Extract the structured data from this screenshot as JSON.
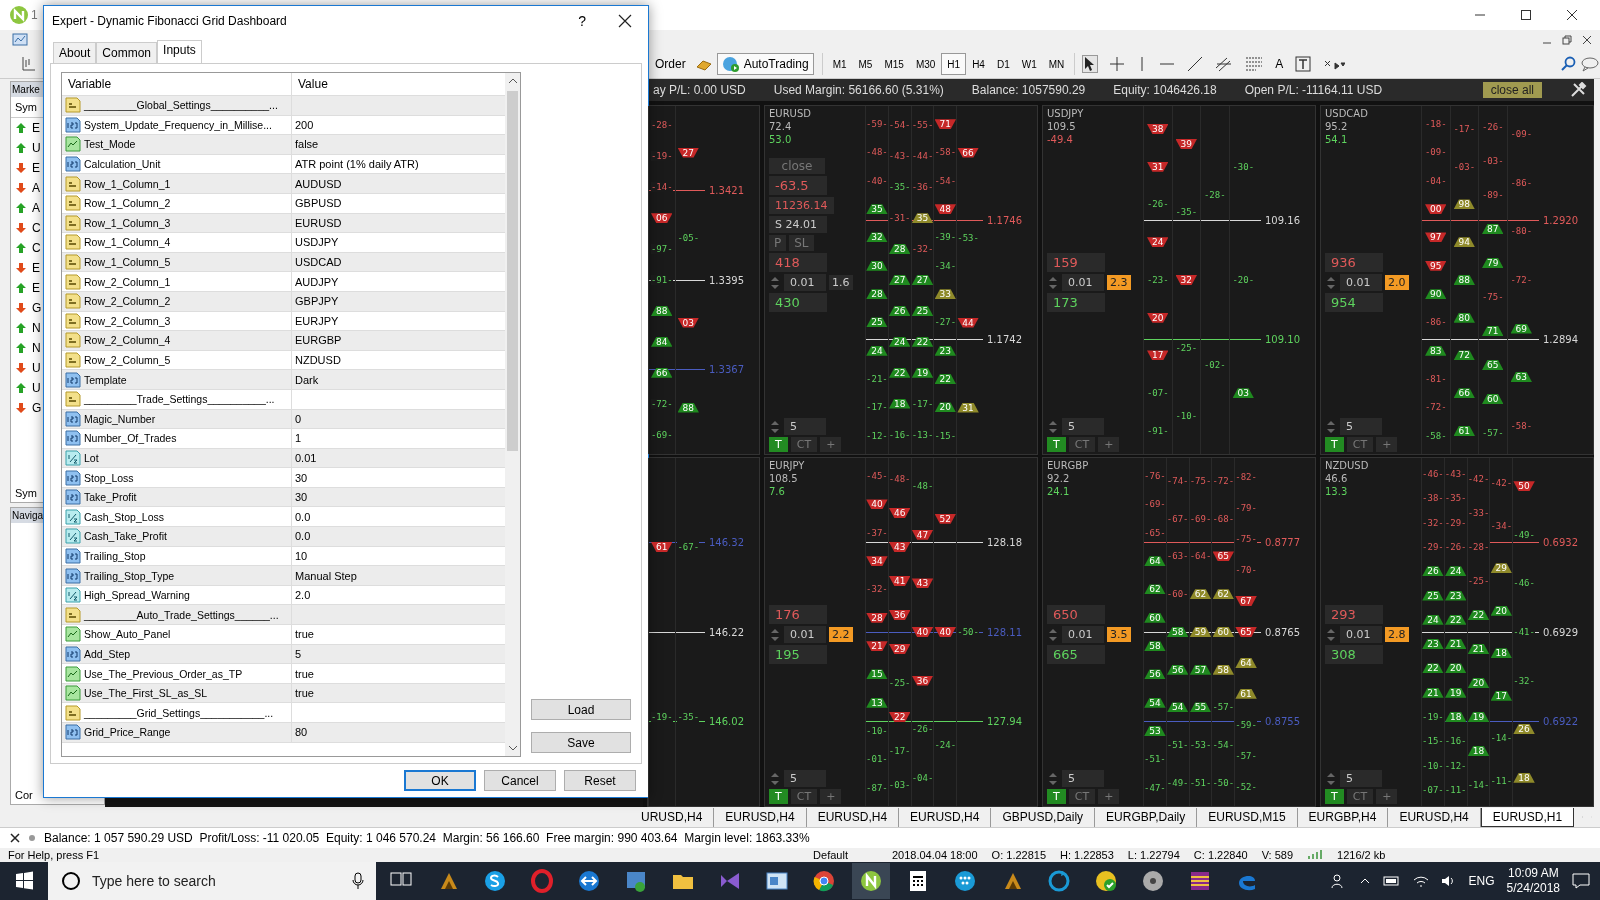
{
  "window": {
    "title_fragment": "1"
  },
  "toolbar": {
    "new_order": "Order",
    "autotrading": "AutoTrading",
    "text_tool": "A",
    "timeframes": [
      {
        "label": "M1",
        "selected": false
      },
      {
        "label": "M5",
        "selected": false
      },
      {
        "label": "M15",
        "selected": false
      },
      {
        "label": "M30",
        "selected": false
      },
      {
        "label": "H1",
        "selected": true
      },
      {
        "label": "H4",
        "selected": false
      },
      {
        "label": "D1",
        "selected": false
      },
      {
        "label": "W1",
        "selected": false
      },
      {
        "label": "MN",
        "selected": false
      }
    ]
  },
  "market_watch": {
    "title": "Marke",
    "header": "Sym",
    "tab": "Sym",
    "rows": [
      {
        "symbol": "E",
        "kind": "up"
      },
      {
        "symbol": "U",
        "kind": "up"
      },
      {
        "symbol": "E",
        "kind": "down"
      },
      {
        "symbol": "A",
        "kind": "down"
      },
      {
        "symbol": "A",
        "kind": "up"
      },
      {
        "symbol": "C",
        "kind": "down"
      },
      {
        "symbol": "C",
        "kind": "up"
      },
      {
        "symbol": "E",
        "kind": "down"
      },
      {
        "symbol": "E",
        "kind": "up"
      },
      {
        "symbol": "G",
        "kind": "down"
      },
      {
        "symbol": "N",
        "kind": "up"
      },
      {
        "symbol": "N",
        "kind": "up"
      },
      {
        "symbol": "U",
        "kind": "down"
      },
      {
        "symbol": "U",
        "kind": "up"
      },
      {
        "symbol": "G",
        "kind": "down"
      }
    ]
  },
  "navigator": {
    "title": "Naviga",
    "tab": "Cor"
  },
  "account_bar": {
    "items": [
      "ay P/L: 0.00 USD",
      "Used Margin: 56166.60 (5.31%)",
      "Balance: 1057590.29",
      "Equity: 1046426.18",
      "Open P/L: -11164.11 USD"
    ],
    "close_all": "close all"
  },
  "panels": [
    {
      "partial": true,
      "columns": [
        [
          {
            "text": "-28-",
            "kind": "dn"
          },
          {
            "text": "-19-",
            "kind": "dn"
          },
          {
            "text": "-14-",
            "kind": "dn"
          },
          {
            "text": "06",
            "kind": "sell"
          },
          {
            "text": "-97-",
            "kind": "up"
          },
          {
            "text": "-91-",
            "kind": "up"
          },
          {
            "text": "88",
            "kind": "buy"
          },
          {
            "text": "84",
            "kind": "buy"
          },
          {
            "text": "66",
            "kind": "buy"
          },
          {
            "text": "-72-",
            "kind": "up"
          },
          {
            "text": "-69-",
            "kind": "up"
          }
        ],
        [
          {
            "text": "27",
            "kind": "sell"
          },
          {
            "text": "-05-",
            "kind": "up"
          },
          {
            "text": "03",
            "kind": "sell"
          },
          {
            "text": "88",
            "kind": "buy"
          }
        ]
      ],
      "price_lines": [
        {
          "label": "1.3421",
          "color": "#e05a5a"
        },
        {
          "label": "1.3395",
          "color": "#d8d8d8"
        },
        {
          "label": "1.3367",
          "color": "#4a5cc0"
        }
      ]
    },
    {
      "symbol": "EURUSD",
      "stat_1": "72.4",
      "stat_2": "53.0",
      "stat_2_negative": false,
      "close_panel": {
        "close": "close",
        "pl": "-63.5",
        "value": "11236.14",
        "swap": "S 24.01",
        "buttons": [
          "P",
          "SL"
        ]
      },
      "sell": "418",
      "lot": "0.01",
      "spread": "1.6",
      "spread_warning": false,
      "buy": "430",
      "step": "5",
      "buttons": [
        {
          "label": "T",
          "on": true
        },
        {
          "label": "CT",
          "on": false
        },
        {
          "label": "+",
          "on": false
        }
      ],
      "columns": [
        [
          {
            "text": "-59-",
            "kind": "dn"
          },
          {
            "text": "-48-",
            "kind": "dn"
          },
          {
            "text": "-40-",
            "kind": "dn"
          },
          {
            "text": "35",
            "kind": "buy"
          },
          {
            "text": "32",
            "kind": "buy"
          },
          {
            "text": "30",
            "kind": "buy"
          },
          {
            "text": "28",
            "kind": "buy"
          },
          {
            "text": "25",
            "kind": "buy"
          },
          {
            "text": "24",
            "kind": "buy"
          },
          {
            "text": "-21-",
            "kind": "up"
          },
          {
            "text": "-17-",
            "kind": "up"
          },
          {
            "text": "-12-",
            "kind": "up"
          }
        ],
        [
          {
            "text": "-54-",
            "kind": "dn"
          },
          {
            "text": "-43-",
            "kind": "dn"
          },
          {
            "text": "-35-",
            "kind": "up"
          },
          {
            "text": "-31-",
            "kind": "dn"
          },
          {
            "text": "28",
            "kind": "buy"
          },
          {
            "text": "27",
            "kind": "buy"
          },
          {
            "text": "26",
            "kind": "buy"
          },
          {
            "text": "24",
            "kind": "buy"
          },
          {
            "text": "22",
            "kind": "buy"
          },
          {
            "text": "18",
            "kind": "buy"
          },
          {
            "text": "-16-",
            "kind": "up"
          }
        ],
        [
          {
            "text": "-55-",
            "kind": "dn"
          },
          {
            "text": "-44-",
            "kind": "dn"
          },
          {
            "text": "-36-",
            "kind": "dn"
          },
          {
            "text": "35",
            "kind": "hold"
          },
          {
            "text": "-32-",
            "kind": "dn"
          },
          {
            "text": "27",
            "kind": "buy"
          },
          {
            "text": "25",
            "kind": "buy"
          },
          {
            "text": "22",
            "kind": "buy"
          },
          {
            "text": "19",
            "kind": "buy"
          },
          {
            "text": "-17-",
            "kind": "up"
          },
          {
            "text": "-13-",
            "kind": "up"
          }
        ],
        [
          {
            "text": "71",
            "kind": "sell"
          },
          {
            "text": "-58-",
            "kind": "dn"
          },
          {
            "text": "-54-",
            "kind": "dn"
          },
          {
            "text": "48",
            "kind": "sell"
          },
          {
            "text": "-39-",
            "kind": "up"
          },
          {
            "text": "-34-",
            "kind": "up"
          },
          {
            "text": "33",
            "kind": "hold"
          },
          {
            "text": "-27-",
            "kind": "up"
          },
          {
            "text": "23",
            "kind": "buy"
          },
          {
            "text": "22",
            "kind": "buy"
          },
          {
            "text": "20",
            "kind": "buy"
          },
          {
            "text": "-15-",
            "kind": "up"
          }
        ],
        [
          {
            "text": "66",
            "kind": "sell"
          },
          {
            "text": "-53-",
            "kind": "up"
          },
          {
            "text": "44",
            "kind": "sell"
          },
          {
            "text": "31",
            "kind": "hold"
          }
        ]
      ],
      "price_lines": [
        {
          "label": "1.1746",
          "color": "#e05a5a"
        },
        {
          "label": "1.1742",
          "color": "#d8d8d8"
        }
      ]
    },
    {
      "symbol": "USDJPY",
      "stat_1": "109.5",
      "stat_2": "-49.4",
      "stat_2_negative": true,
      "sell": "159",
      "lot": "0.01",
      "spread": "2.3",
      "spread_warning": true,
      "buy": "173",
      "step": "5",
      "buttons": [
        {
          "label": "T",
          "on": true
        },
        {
          "label": "CT",
          "on": false
        },
        {
          "label": "+",
          "on": false
        }
      ],
      "columns": [
        [
          {
            "text": "38",
            "kind": "sell"
          },
          {
            "text": "31",
            "kind": "sell"
          },
          {
            "text": "-26-",
            "kind": "up"
          },
          {
            "text": "24",
            "kind": "sell"
          },
          {
            "text": "-23-",
            "kind": "up"
          },
          {
            "text": "20",
            "kind": "sell"
          },
          {
            "text": "17",
            "kind": "sell"
          },
          {
            "text": "-07-",
            "kind": "up"
          },
          {
            "text": "-91-",
            "kind": "up"
          }
        ],
        [
          {
            "text": "39",
            "kind": "sell"
          },
          {
            "text": "-35-",
            "kind": "up"
          },
          {
            "text": "32",
            "kind": "sell"
          },
          {
            "text": "-25-",
            "kind": "up"
          },
          {
            "text": "-10-",
            "kind": "up"
          }
        ],
        [
          {
            "text": "-28-",
            "kind": "up"
          },
          {
            "text": "-02-",
            "kind": "up"
          }
        ],
        [
          {
            "text": "-30-",
            "kind": "up"
          },
          {
            "text": "-20-",
            "kind": "up"
          },
          {
            "text": "03",
            "kind": "buy"
          }
        ]
      ],
      "price_lines": [
        {
          "label": "109.16",
          "color": "#d8d8d8"
        },
        {
          "label": "109.10",
          "color": "#5ed35e"
        }
      ]
    },
    {
      "symbol": "USDCAD",
      "stat_1": "95.2",
      "stat_2": "54.1",
      "stat_2_negative": false,
      "sell": "936",
      "lot": "0.01",
      "spread": "2.0",
      "spread_warning": true,
      "buy": "954",
      "step": "5",
      "buttons": [
        {
          "label": "T",
          "on": true
        },
        {
          "label": "CT",
          "on": false
        },
        {
          "label": "+",
          "on": false
        }
      ],
      "columns": [
        [
          {
            "text": "-18-",
            "kind": "dn"
          },
          {
            "text": "-09-",
            "kind": "dn"
          },
          {
            "text": "-04-",
            "kind": "dn"
          },
          {
            "text": "00",
            "kind": "sell"
          },
          {
            "text": "97",
            "kind": "sell"
          },
          {
            "text": "95",
            "kind": "sell"
          },
          {
            "text": "90",
            "kind": "buy"
          },
          {
            "text": "-86-",
            "kind": "dn"
          },
          {
            "text": "83",
            "kind": "buy"
          },
          {
            "text": "-81-",
            "kind": "dn"
          },
          {
            "text": "-72-",
            "kind": "dn"
          },
          {
            "text": "-58-",
            "kind": "up"
          }
        ],
        [
          {
            "text": "-17-",
            "kind": "dn"
          },
          {
            "text": "-03-",
            "kind": "dn"
          },
          {
            "text": "98",
            "kind": "hold"
          },
          {
            "text": "94",
            "kind": "hold"
          },
          {
            "text": "88",
            "kind": "buy"
          },
          {
            "text": "80",
            "kind": "buy"
          },
          {
            "text": "72",
            "kind": "buy"
          },
          {
            "text": "66",
            "kind": "buy"
          },
          {
            "text": "61",
            "kind": "buy"
          }
        ],
        [
          {
            "text": "-26-",
            "kind": "dn"
          },
          {
            "text": "-03-",
            "kind": "dn"
          },
          {
            "text": "-89-",
            "kind": "dn"
          },
          {
            "text": "87",
            "kind": "buy"
          },
          {
            "text": "79",
            "kind": "buy"
          },
          {
            "text": "-75-",
            "kind": "dn"
          },
          {
            "text": "71",
            "kind": "buy"
          },
          {
            "text": "65",
            "kind": "buy"
          },
          {
            "text": "60",
            "kind": "buy"
          },
          {
            "text": "-57-",
            "kind": "up"
          }
        ],
        [
          {
            "text": "-09-",
            "kind": "dn"
          },
          {
            "text": "-86-",
            "kind": "dn"
          },
          {
            "text": "-80-",
            "kind": "dn"
          },
          {
            "text": "-72-",
            "kind": "dn"
          },
          {
            "text": "69",
            "kind": "buy"
          },
          {
            "text": "63",
            "kind": "buy"
          },
          {
            "text": "-58-",
            "kind": "dn"
          }
        ]
      ],
      "price_lines": [
        {
          "label": "1.2920",
          "color": "#e05a5a"
        },
        {
          "label": "1.2894",
          "color": "#d8d8d8"
        }
      ]
    },
    {
      "partial": true,
      "columns": [
        [
          {
            "text": "61",
            "kind": "sell"
          },
          {
            "text": "-19-",
            "kind": "up"
          }
        ],
        [
          {
            "text": "-67-",
            "kind": "up"
          },
          {
            "text": "-35-",
            "kind": "up"
          }
        ]
      ],
      "price_lines": [
        {
          "label": "146.32",
          "color": "#4a5cc0"
        },
        {
          "label": "146.22",
          "color": "#d8d8d8"
        },
        {
          "label": "146.02",
          "color": "#5ed35e"
        }
      ]
    },
    {
      "symbol": "EURJPY",
      "stat_1": "108.5",
      "stat_2": "7.6",
      "stat_2_negative": false,
      "sell": "176",
      "lot": "0.01",
      "spread": "2.2",
      "spread_warning": true,
      "buy": "195",
      "step": "5",
      "buttons": [
        {
          "label": "T",
          "on": true
        },
        {
          "label": "CT",
          "on": false
        },
        {
          "label": "+",
          "on": false
        }
      ],
      "columns": [
        [
          {
            "text": "-45-",
            "kind": "dn"
          },
          {
            "text": "40",
            "kind": "sell"
          },
          {
            "text": "-37-",
            "kind": "dn"
          },
          {
            "text": "34",
            "kind": "sell"
          },
          {
            "text": "-32-",
            "kind": "dn"
          },
          {
            "text": "28",
            "kind": "sell"
          },
          {
            "text": "21",
            "kind": "sell"
          },
          {
            "text": "15",
            "kind": "buy"
          },
          {
            "text": "13",
            "kind": "buy"
          },
          {
            "text": "-10-",
            "kind": "up"
          },
          {
            "text": "-01-",
            "kind": "up"
          },
          {
            "text": "-87-",
            "kind": "up"
          }
        ],
        [
          {
            "text": "-48-",
            "kind": "dn"
          },
          {
            "text": "46",
            "kind": "sell"
          },
          {
            "text": "43",
            "kind": "sell"
          },
          {
            "text": "41",
            "kind": "sell"
          },
          {
            "text": "36",
            "kind": "sell"
          },
          {
            "text": "29",
            "kind": "sell"
          },
          {
            "text": "-25-",
            "kind": "up"
          },
          {
            "text": "22",
            "kind": "sell"
          },
          {
            "text": "-17-",
            "kind": "up"
          },
          {
            "text": "-03-",
            "kind": "up"
          }
        ],
        [
          {
            "text": "-48-",
            "kind": "up"
          },
          {
            "text": "47",
            "kind": "sell"
          },
          {
            "text": "43",
            "kind": "sell"
          },
          {
            "text": "40",
            "kind": "sell"
          },
          {
            "text": "36",
            "kind": "sell"
          },
          {
            "text": "-26-",
            "kind": "up"
          },
          {
            "text": "-04-",
            "kind": "up"
          }
        ],
        [
          {
            "text": "52",
            "kind": "sell"
          },
          {
            "text": "40",
            "kind": "sell"
          },
          {
            "text": "-24-",
            "kind": "up"
          }
        ],
        [
          {
            "text": "-50-",
            "kind": "up"
          }
        ]
      ],
      "price_lines": [
        {
          "label": "128.18",
          "color": "#d8d8d8"
        },
        {
          "label": "128.11",
          "color": "#4a5cc0"
        },
        {
          "label": "127.94",
          "color": "#5ed35e"
        }
      ]
    },
    {
      "symbol": "EURGBP",
      "stat_1": "92.2",
      "stat_2": "24.1",
      "stat_2_negative": false,
      "sell": "650",
      "lot": "0.01",
      "spread": "3.5",
      "spread_warning": true,
      "buy": "665",
      "step": "5",
      "buttons": [
        {
          "label": "T",
          "on": true
        },
        {
          "label": "CT",
          "on": false
        },
        {
          "label": "+",
          "on": false
        }
      ],
      "columns": [
        [
          {
            "text": "-76-",
            "kind": "dn"
          },
          {
            "text": "-69-",
            "kind": "dn"
          },
          {
            "text": "-65-",
            "kind": "dn"
          },
          {
            "text": "64",
            "kind": "buy"
          },
          {
            "text": "62",
            "kind": "buy"
          },
          {
            "text": "60",
            "kind": "buy"
          },
          {
            "text": "58",
            "kind": "buy"
          },
          {
            "text": "56",
            "kind": "buy"
          },
          {
            "text": "54",
            "kind": "buy"
          },
          {
            "text": "53",
            "kind": "buy"
          },
          {
            "text": "-51-",
            "kind": "up"
          },
          {
            "text": "-47-",
            "kind": "up"
          }
        ],
        [
          {
            "text": "-74-",
            "kind": "dn"
          },
          {
            "text": "-67-",
            "kind": "dn"
          },
          {
            "text": "-63-",
            "kind": "dn"
          },
          {
            "text": "-60-",
            "kind": "dn"
          },
          {
            "text": "58",
            "kind": "buy"
          },
          {
            "text": "56",
            "kind": "buy"
          },
          {
            "text": "54",
            "kind": "buy"
          },
          {
            "text": "-51-",
            "kind": "up"
          },
          {
            "text": "-49-",
            "kind": "up"
          }
        ],
        [
          {
            "text": "-75-",
            "kind": "dn"
          },
          {
            "text": "-69-",
            "kind": "dn"
          },
          {
            "text": "-64-",
            "kind": "dn"
          },
          {
            "text": "62",
            "kind": "hold"
          },
          {
            "text": "59",
            "kind": "hold"
          },
          {
            "text": "57",
            "kind": "buy"
          },
          {
            "text": "55",
            "kind": "buy"
          },
          {
            "text": "-53-",
            "kind": "up"
          },
          {
            "text": "-51-",
            "kind": "up"
          }
        ],
        [
          {
            "text": "-72-",
            "kind": "dn"
          },
          {
            "text": "-68-",
            "kind": "dn"
          },
          {
            "text": "65",
            "kind": "sell"
          },
          {
            "text": "62",
            "kind": "hold"
          },
          {
            "text": "60",
            "kind": "hold"
          },
          {
            "text": "58",
            "kind": "hold"
          },
          {
            "text": "-57-",
            "kind": "up"
          },
          {
            "text": "-54-",
            "kind": "up"
          },
          {
            "text": "-50-",
            "kind": "up"
          }
        ],
        [
          {
            "text": "-82-",
            "kind": "dn"
          },
          {
            "text": "-79-",
            "kind": "dn"
          },
          {
            "text": "-75-",
            "kind": "dn"
          },
          {
            "text": "-70-",
            "kind": "dn"
          },
          {
            "text": "67",
            "kind": "sell"
          },
          {
            "text": "65",
            "kind": "sell"
          },
          {
            "text": "64",
            "kind": "hold"
          },
          {
            "text": "61",
            "kind": "hold"
          },
          {
            "text": "-59-",
            "kind": "up"
          },
          {
            "text": "-57-",
            "kind": "up"
          },
          {
            "text": "-52-",
            "kind": "up"
          }
        ]
      ],
      "price_lines": [
        {
          "label": "0.8777",
          "color": "#e05a5a"
        },
        {
          "label": "0.8765",
          "color": "#d8d8d8"
        },
        {
          "label": "0.8755",
          "color": "#4a5cc0"
        }
      ]
    },
    {
      "symbol": "NZDUSD",
      "stat_1": "46.6",
      "stat_2": "13.3",
      "stat_2_negative": false,
      "sell": "293",
      "lot": "0.01",
      "spread": "2.8",
      "spread_warning": true,
      "buy": "308",
      "step": "5",
      "buttons": [
        {
          "label": "T",
          "on": true
        },
        {
          "label": "CT",
          "on": false
        },
        {
          "label": "+",
          "on": false
        }
      ],
      "columns": [
        [
          {
            "text": "-46-",
            "kind": "dn"
          },
          {
            "text": "-38-",
            "kind": "dn"
          },
          {
            "text": "-32-",
            "kind": "dn"
          },
          {
            "text": "-29-",
            "kind": "dn"
          },
          {
            "text": "26",
            "kind": "buy"
          },
          {
            "text": "25",
            "kind": "buy"
          },
          {
            "text": "24",
            "kind": "buy"
          },
          {
            "text": "23",
            "kind": "buy"
          },
          {
            "text": "22",
            "kind": "buy"
          },
          {
            "text": "21",
            "kind": "buy"
          },
          {
            "text": "-19-",
            "kind": "up"
          },
          {
            "text": "-15-",
            "kind": "up"
          },
          {
            "text": "-10-",
            "kind": "up"
          },
          {
            "text": "-07-",
            "kind": "up"
          }
        ],
        [
          {
            "text": "-43-",
            "kind": "dn"
          },
          {
            "text": "-35-",
            "kind": "dn"
          },
          {
            "text": "-29-",
            "kind": "dn"
          },
          {
            "text": "-26-",
            "kind": "dn"
          },
          {
            "text": "24",
            "kind": "buy"
          },
          {
            "text": "23",
            "kind": "buy"
          },
          {
            "text": "22",
            "kind": "buy"
          },
          {
            "text": "21",
            "kind": "buy"
          },
          {
            "text": "20",
            "kind": "buy"
          },
          {
            "text": "19",
            "kind": "buy"
          },
          {
            "text": "18",
            "kind": "buy"
          },
          {
            "text": "-16-",
            "kind": "up"
          },
          {
            "text": "-12-",
            "kind": "up"
          },
          {
            "text": "-11-",
            "kind": "up"
          }
        ],
        [
          {
            "text": "-42-",
            "kind": "dn"
          },
          {
            "text": "-33-",
            "kind": "dn"
          },
          {
            "text": "-28-",
            "kind": "dn"
          },
          {
            "text": "-25-",
            "kind": "dn"
          },
          {
            "text": "22",
            "kind": "buy"
          },
          {
            "text": "21",
            "kind": "buy"
          },
          {
            "text": "20",
            "kind": "buy"
          },
          {
            "text": "19",
            "kind": "buy"
          },
          {
            "text": "18",
            "kind": "buy"
          },
          {
            "text": "-14-",
            "kind": "up"
          }
        ],
        [
          {
            "text": "-42-",
            "kind": "dn"
          },
          {
            "text": "-34-",
            "kind": "dn"
          },
          {
            "text": "29",
            "kind": "hold"
          },
          {
            "text": "20",
            "kind": "buy"
          },
          {
            "text": "18",
            "kind": "buy"
          },
          {
            "text": "17",
            "kind": "buy"
          },
          {
            "text": "-14-",
            "kind": "up"
          },
          {
            "text": "-11-",
            "kind": "up"
          }
        ],
        [
          {
            "text": "50",
            "kind": "sell"
          },
          {
            "text": "-49-",
            "kind": "up"
          },
          {
            "text": "-46-",
            "kind": "up"
          },
          {
            "text": "-41-",
            "kind": "up"
          },
          {
            "text": "-32-",
            "kind": "up"
          },
          {
            "text": "26",
            "kind": "hold"
          },
          {
            "text": "18",
            "kind": "hold"
          }
        ]
      ],
      "price_lines": [
        {
          "label": "0.6932",
          "color": "#e05a5a"
        },
        {
          "label": "0.6929",
          "color": "#d8d8d8"
        },
        {
          "label": "0.6922",
          "color": "#4a5cc0"
        }
      ]
    }
  ],
  "chart_tabs": [
    {
      "label": "URUSD,H4",
      "selected": false
    },
    {
      "label": "EURUSD,H4",
      "selected": false
    },
    {
      "label": "EURUSD,H4",
      "selected": false
    },
    {
      "label": "EURUSD,H4",
      "selected": false
    },
    {
      "label": "GBPUSD,Daily",
      "selected": false
    },
    {
      "label": "EURGBP,Daily",
      "selected": false
    },
    {
      "label": "EURUSD,M15",
      "selected": false
    },
    {
      "label": "EURGBP,H4",
      "selected": false
    },
    {
      "label": "EURUSD,H4",
      "selected": false
    },
    {
      "label": "EURUSD,H1",
      "selected": true
    }
  ],
  "terminal_line": "Balance: 1 057 590.29 USD  Profit/Loss: -11 020.05  Equity: 1 046 570.24  Margin: 56 166.60  Free margin: 990 403.64  Margin level: 1863.33%",
  "status_bar": [
    "For Help, press F1",
    "Default",
    "2018.04.04 18:00",
    "O: 1.22815",
    "H: 1.22853",
    "L: 1.22794",
    "C: 1.22840",
    "V: 589",
    "1216/2 kb"
  ],
  "dialog": {
    "title": "Expert - Dynamic Fibonacci Grid Dashboard",
    "help": "?",
    "tabs": [
      {
        "label": "About",
        "selected": false
      },
      {
        "label": "Common",
        "selected": false
      },
      {
        "label": "Inputs",
        "selected": true
      }
    ],
    "columns": [
      "Variable",
      "Value"
    ],
    "rows": [
      {
        "kind": "text",
        "name": "_________Global_Settings__________..."
      },
      {
        "kind": "int",
        "name": "System_Update_Frequency_in_Millise...",
        "value": "200"
      },
      {
        "kind": "bool",
        "name": "Test_Mode",
        "value": "false"
      },
      {
        "kind": "int",
        "name": "Calculation_Unit",
        "value": "ATR point (1% daily ATR)"
      },
      {
        "kind": "text",
        "name": "Row_1_Column_1",
        "value": "AUDUSD"
      },
      {
        "kind": "text",
        "name": "Row_1_Column_2",
        "value": "GBPUSD"
      },
      {
        "kind": "text",
        "name": "Row_1_Column_3",
        "value": "EURUSD"
      },
      {
        "kind": "text",
        "name": "Row_1_Column_4",
        "value": "USDJPY"
      },
      {
        "kind": "text",
        "name": "Row_1_Column_5",
        "value": "USDCAD"
      },
      {
        "kind": "text",
        "name": "Row_2_Column_1",
        "value": "AUDJPY"
      },
      {
        "kind": "text",
        "name": "Row_2_Column_2",
        "value": "GBPJPY"
      },
      {
        "kind": "text",
        "name": "Row_2_Column_3",
        "value": "EURJPY"
      },
      {
        "kind": "text",
        "name": "Row_2_Column_4",
        "value": "EURGBP"
      },
      {
        "kind": "text",
        "name": "Row_2_Column_5",
        "value": "NZDUSD"
      },
      {
        "kind": "int",
        "name": "Template",
        "value": "Dark"
      },
      {
        "kind": "text",
        "name": "_________Trade_Settings__________..."
      },
      {
        "kind": "int",
        "name": "Magic_Number",
        "value": "0"
      },
      {
        "kind": "int",
        "name": "Number_Of_Trades",
        "value": "1"
      },
      {
        "kind": "double",
        "name": "Lot",
        "value": "0.01"
      },
      {
        "kind": "int",
        "name": "Stop_Loss",
        "value": "30"
      },
      {
        "kind": "int",
        "name": "Take_Profit",
        "value": "30"
      },
      {
        "kind": "double",
        "name": "Cash_Stop_Loss",
        "value": "0.0"
      },
      {
        "kind": "double",
        "name": "Cash_Take_Profit",
        "value": "0.0"
      },
      {
        "kind": "int",
        "name": "Trailing_Stop",
        "value": "10"
      },
      {
        "kind": "int",
        "name": "Trailing_Stop_Type",
        "value": "Manual Step"
      },
      {
        "kind": "double",
        "name": "High_Spread_Warning",
        "value": "2.0"
      },
      {
        "kind": "text",
        "name": "_________Auto_Trade_Settings______..."
      },
      {
        "kind": "bool",
        "name": "Show_Auto_Panel",
        "value": "true"
      },
      {
        "kind": "int",
        "name": "Add_Step",
        "value": "5"
      },
      {
        "kind": "bool",
        "name": "Use_The_Previous_Order_as_TP",
        "value": "true"
      },
      {
        "kind": "bool",
        "name": "Use_The_First_SL_as_SL",
        "value": "true"
      },
      {
        "kind": "text",
        "name": "_________Grid_Settings___________..."
      },
      {
        "kind": "int",
        "name": "Grid_Price_Range",
        "value": "80"
      }
    ],
    "side_buttons": [
      "Load",
      "Save"
    ],
    "buttons": [
      {
        "label": "OK",
        "default": true
      },
      {
        "label": "Cancel",
        "default": false
      },
      {
        "label": "Reset",
        "default": false
      }
    ]
  },
  "taskbar": {
    "search_placeholder": "Type here to search",
    "apps": [
      {
        "kind": "taskview",
        "active": false
      },
      {
        "kind": "gold",
        "active": false
      },
      {
        "kind": "skype",
        "active": false
      },
      {
        "kind": "opera",
        "active": false
      },
      {
        "kind": "remote",
        "active": false
      },
      {
        "kind": "globe",
        "active": false
      },
      {
        "kind": "folder",
        "active": false
      },
      {
        "kind": "studio",
        "active": false
      },
      {
        "kind": "window",
        "active": false
      },
      {
        "kind": "chrome",
        "active": false
      },
      {
        "kind": "n",
        "active": true
      },
      {
        "kind": "calc",
        "active": false
      },
      {
        "kind": "dots",
        "active": false
      },
      {
        "kind": "gold",
        "active": false
      },
      {
        "kind": "sync",
        "active": false
      },
      {
        "kind": "check",
        "active": false
      },
      {
        "kind": "disc",
        "active": false
      },
      {
        "kind": "archive",
        "active": false
      },
      {
        "kind": "edge",
        "active": false
      }
    ],
    "language": "ENG",
    "time": "10:09 AM",
    "date": "5/24/2018"
  }
}
